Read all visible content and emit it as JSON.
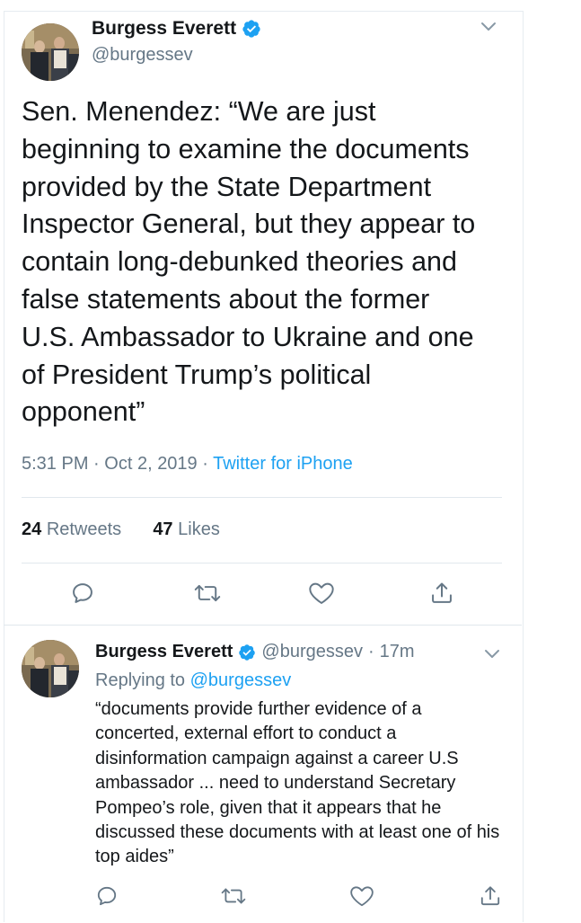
{
  "main_tweet": {
    "author_name": "Burgess Everett",
    "author_handle": "@burgessev",
    "text": "Sen. Menendez: “We are just\nbeginning to examine the documents\nprovided by the State Department\nInspector General, but they appear to\ncontain long-debunked theories and\nfalse statements about the former\nU.S. Ambassador to Ukraine and one\nof President Trump’s political\nopponent”",
    "time": "5:31 PM",
    "date": "Oct 2, 2019",
    "separator": "·",
    "source": "Twitter for iPhone",
    "retweets_count": "24",
    "retweets_label": "Retweets",
    "likes_count": "47",
    "likes_label": "Likes"
  },
  "reply_tweet": {
    "author_name": "Burgess Everett",
    "author_handle": "@burgessev",
    "separator": "·",
    "age": "17m",
    "replying_to_label": "Replying to",
    "replying_to_handle": "@burgessev",
    "text": "“documents provide further evidence of a concerted, external effort to conduct a disinformation campaign against a career U.S ambassador ... need to understand Secretary Pompeo’s role, given that it appears that he discussed these documents with at least one of his top aides”"
  },
  "icons": {
    "reply": "reply-icon",
    "retweet": "retweet-icon",
    "like": "heart-icon",
    "share": "share-icon",
    "verified": "verified-badge-icon",
    "more": "chevron-down-icon"
  },
  "colors": {
    "text": "#14171a",
    "secondary": "#657786",
    "link": "#1da1f2",
    "icon": "#657786",
    "divider": "#e1e8ed"
  }
}
